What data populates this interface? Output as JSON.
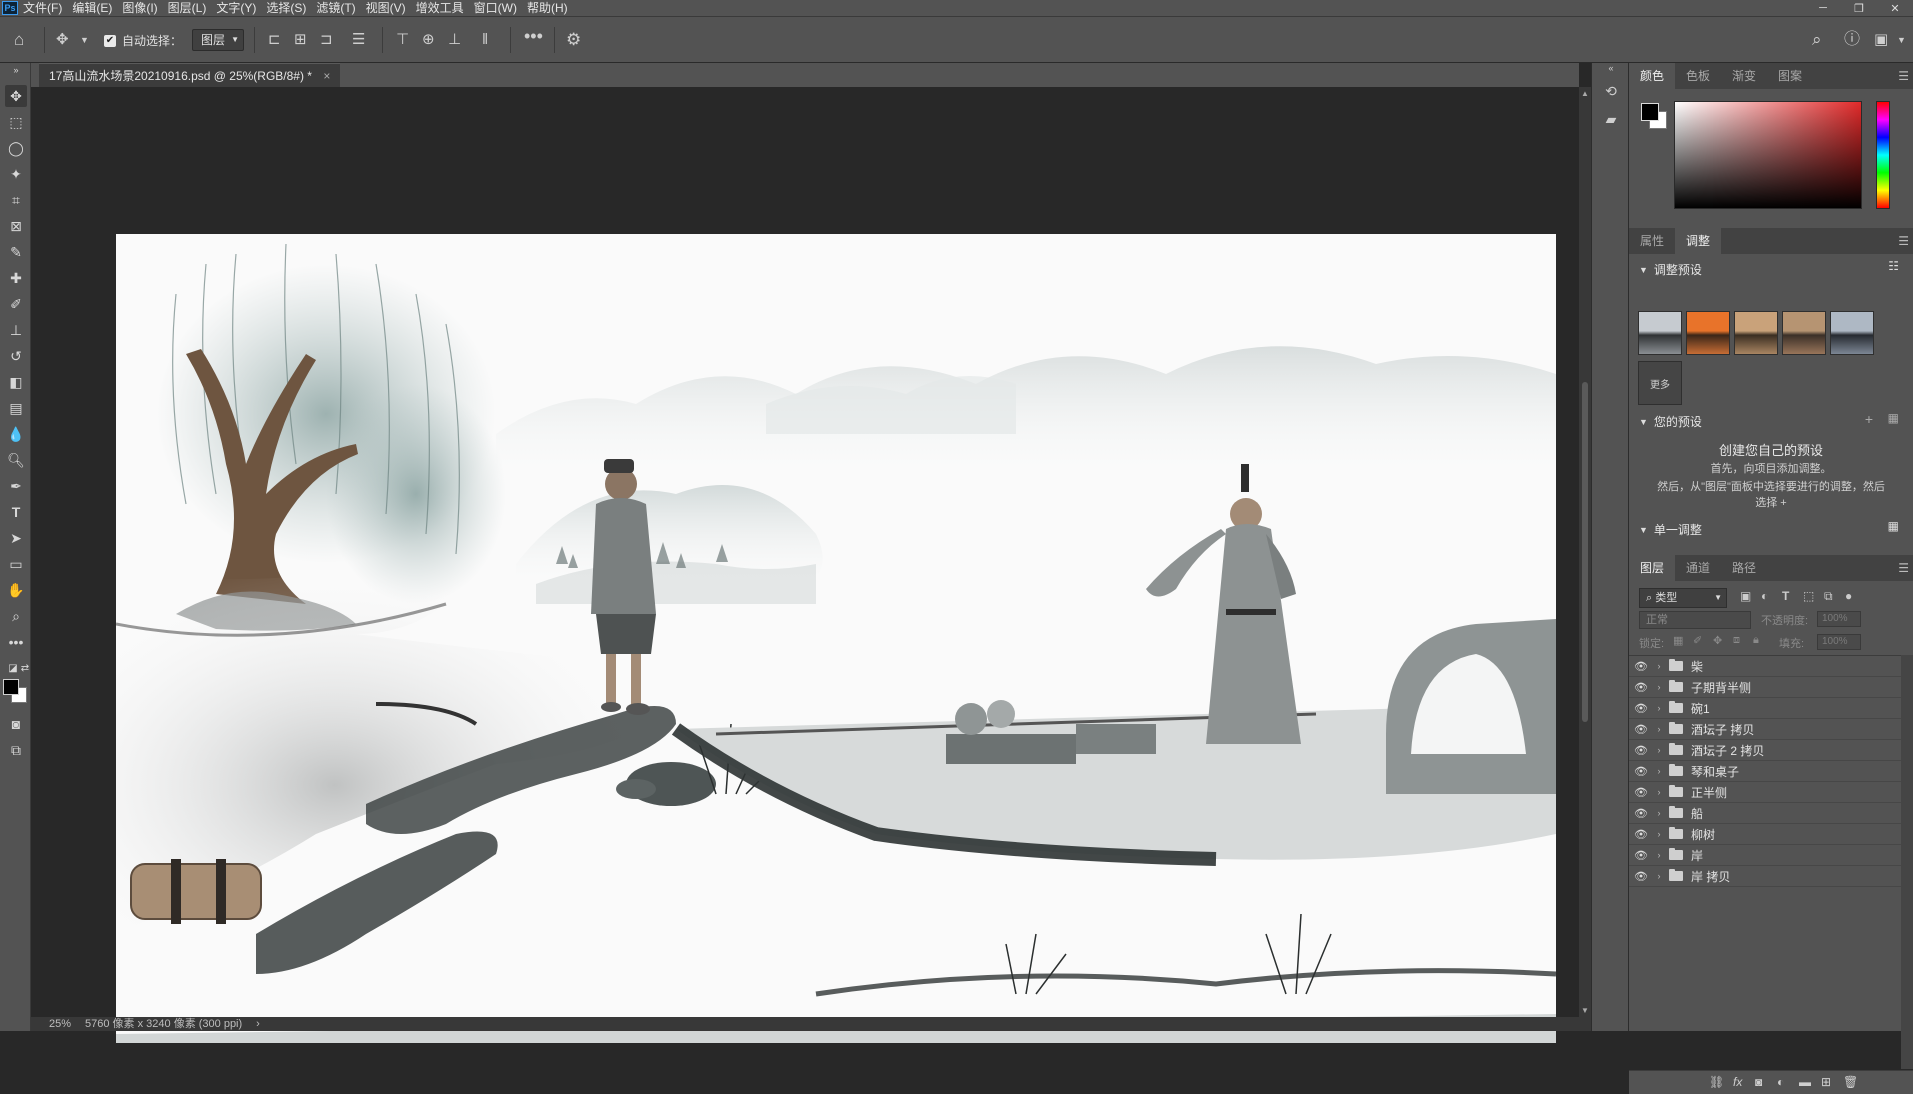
{
  "app": {
    "logo": "Ps"
  },
  "menu": [
    "文件(F)",
    "编辑(E)",
    "图像(I)",
    "图层(L)",
    "文字(Y)",
    "选择(S)",
    "滤镜(T)",
    "视图(V)",
    "增效工具",
    "窗口(W)",
    "帮助(H)"
  ],
  "options": {
    "auto_select_label": "自动选择：",
    "auto_select_target": "图层"
  },
  "document": {
    "tab_title": "17高山流水场景20210916.psd @ 25%(RGB/8#) *",
    "close_glyph": "×"
  },
  "status": {
    "zoom": "25%",
    "info": "5760 像素 x 3240 像素 (300 ppi)"
  },
  "color_panel": {
    "tabs": [
      "颜色",
      "色板",
      "渐变",
      "图案"
    ],
    "active": 0,
    "foreground": "#000000",
    "background": "#ffffff",
    "hue": "#e12a2a"
  },
  "adjust_panel": {
    "tabs": [
      "属性",
      "调整"
    ],
    "active": 1,
    "presets_title": "调整预设",
    "more_label": "更多",
    "your_presets_title": "您的预设",
    "create_title": "创建您自己的预设",
    "create_line1": "首先，向项目添加调整。",
    "create_line2": "然后，从\"图层\"面板中选择要进行的调整，然后",
    "create_line3": "选择 +",
    "single_title": "单一调整"
  },
  "layers_panel": {
    "tabs": [
      "图层",
      "通道",
      "路径"
    ],
    "active": 0,
    "filter_label": "类型",
    "blend_mode": "正常",
    "opacity_label": "不透明度:",
    "opacity_value": "100%",
    "lock_label": "锁定:",
    "fill_label": "填充:",
    "fill_value": "100%",
    "layers": [
      {
        "name": "柴"
      },
      {
        "name": "子期背半侧"
      },
      {
        "name": "碗1"
      },
      {
        "name": "酒坛子 拷贝"
      },
      {
        "name": "酒坛子 2 拷贝"
      },
      {
        "name": "琴和桌子"
      },
      {
        "name": "正半侧"
      },
      {
        "name": "船"
      },
      {
        "name": "柳树"
      },
      {
        "name": "岸"
      },
      {
        "name": "岸 拷贝"
      }
    ]
  }
}
